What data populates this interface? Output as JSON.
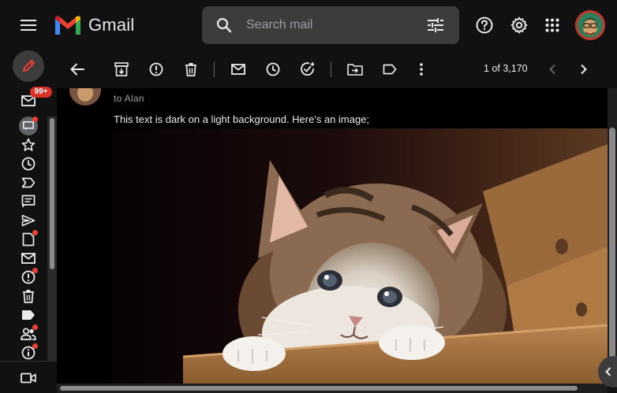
{
  "header": {
    "app_name": "Gmail",
    "search": {
      "placeholder": "Search mail"
    },
    "buttons": [
      "main-menu",
      "support",
      "settings",
      "google-apps",
      "account"
    ]
  },
  "nav": {
    "inbox_badge": "99+",
    "items": [
      "compose",
      "inbox",
      "chat",
      "starred",
      "snoozed",
      "important",
      "chats",
      "sent",
      "drafts",
      "all-mail",
      "spam",
      "trash",
      "categories",
      "contacts",
      "info",
      "meet"
    ]
  },
  "toolbar": {
    "pager": "1 of 3,170"
  },
  "message": {
    "to_line": "to Alan",
    "body_text": "This text is dark on a light background. Here's an image;"
  },
  "colors": {
    "background": "#111111",
    "search_bg": "#3c3c3c",
    "badge": "#d93025",
    "unread_dot": "#ea4335",
    "text": "#e8eaed",
    "muted_text": "#9aa0a6"
  }
}
